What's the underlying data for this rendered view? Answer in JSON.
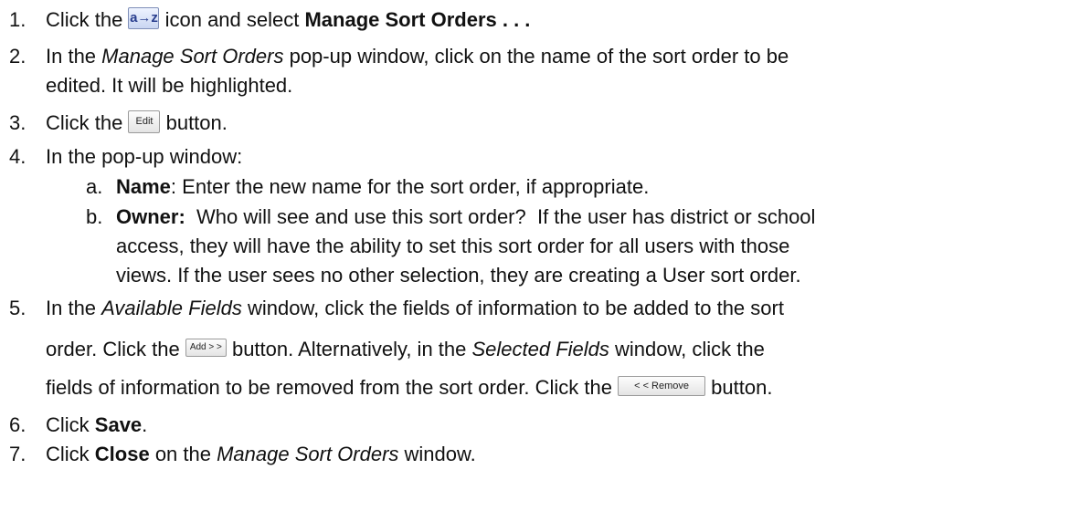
{
  "steps": [
    {
      "num": "1.",
      "t1": "Click the ",
      "icon": "a-z-sort-icon",
      "icon_text": "a→z",
      "t2": " icon and select ",
      "b1": "Manage Sort Orders . . ."
    },
    {
      "num": "2.",
      "t1": "In the ",
      "i1": "Manage Sort Orders",
      "t2": " pop-up window, click on the name of the sort order to be",
      "line2": "edited.  It will be highlighted."
    },
    {
      "num": "3.",
      "t1": "Click the ",
      "button": "Edit",
      "t2": " button."
    },
    {
      "num": "4.",
      "t1": "In the pop-up window:"
    },
    {
      "num": "5.",
      "t1": "In the ",
      "i1": "Available Fields",
      "t2": " window, click the fields of information to be added to the sort",
      "l2a": "order.  Click the ",
      "button": "Add > >",
      "l2b": " button.  Alternatively, in the ",
      "i2": "Selected Fields",
      "l2c": " window, click the",
      "l3a": "fields of information to be removed from the sort order.  Click the ",
      "button2": "< < Remove",
      "l3b": " button."
    },
    {
      "num": "6.",
      "t1": "Click ",
      "b1": "Save",
      "t2": "."
    },
    {
      "num": "7.",
      "t1": "Click ",
      "b1": "Close",
      "t2": " on the ",
      "i1": "Manage Sort Orders",
      "t3": " window."
    }
  ],
  "substeps": [
    {
      "letter": "a.",
      "label": "Name",
      "text": ":  Enter the new name for the sort order, if appropriate."
    },
    {
      "letter": "b.",
      "label": "Owner:",
      "lines": [
        "  Who will see and use this sort order?  If the user has district or school",
        "access, they will have the ability to set this sort order for all users with those",
        "views.  If the user sees no other selection, they are creating a User sort order."
      ]
    }
  ]
}
